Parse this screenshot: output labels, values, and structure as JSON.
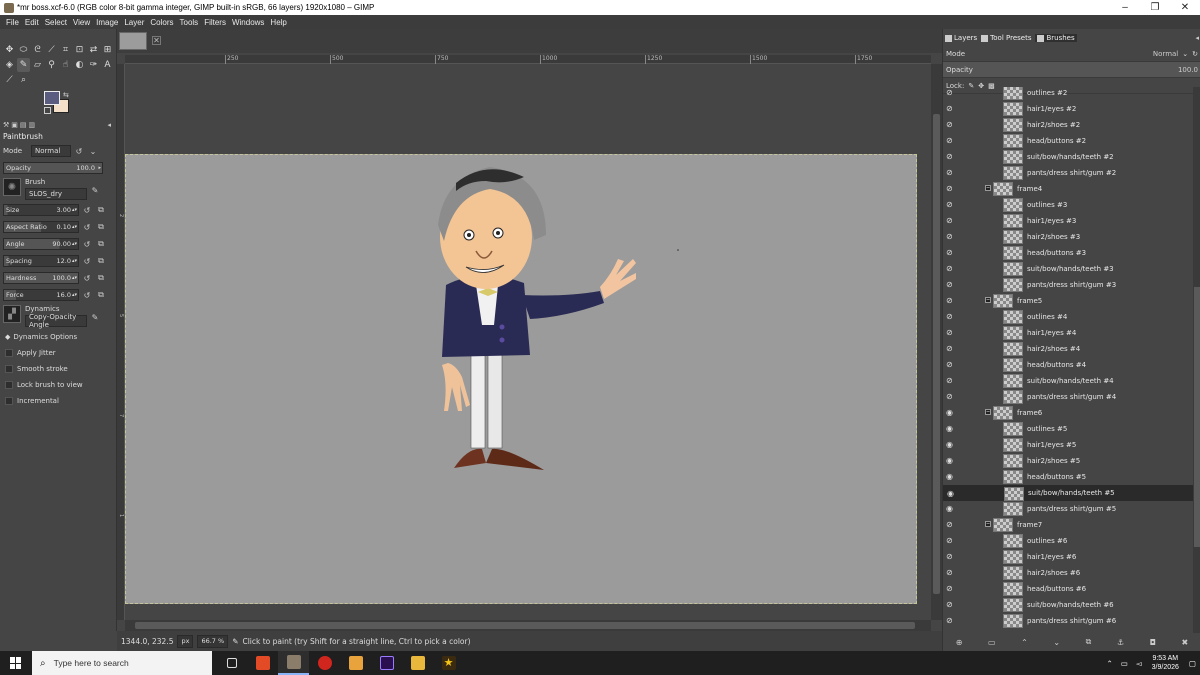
{
  "window": {
    "title": "*mr boss.xcf-6.0 (RGB color 8-bit gamma integer, GIMP built-in sRGB, 66 layers) 1920x1080 – GIMP"
  },
  "menu": [
    "File",
    "Edit",
    "Select",
    "View",
    "Image",
    "Layer",
    "Colors",
    "Tools",
    "Filters",
    "Windows",
    "Help"
  ],
  "tool_options": {
    "title": "Paintbrush",
    "mode_label": "Mode",
    "mode_value": "Normal",
    "opacity_label": "Opacity",
    "opacity_value": "100.0",
    "brush_label": "Brush",
    "brush_value": "SLOS_dry",
    "sliders": [
      {
        "label": "Size",
        "value": "3.00",
        "fill": 0.05
      },
      {
        "label": "Aspect Ratio",
        "value": "0.10",
        "fill": 0.5
      },
      {
        "label": "Angle",
        "value": "90.00",
        "fill": 0.75
      },
      {
        "label": "Spacing",
        "value": "12.0",
        "fill": 0.06
      },
      {
        "label": "Hardness",
        "value": "100.0",
        "fill": 1.0
      },
      {
        "label": "Force",
        "value": "16.0",
        "fill": 0.16
      }
    ],
    "dynamics_label": "Dynamics",
    "dynamics_value": "Copy-Opacity Angle",
    "dynamics_options": "Dynamics Options",
    "checks": [
      "Apply Jitter",
      "Smooth stroke",
      "Lock brush to view",
      "Incremental"
    ]
  },
  "ruler": {
    "ticks": [
      "250",
      "500",
      "750",
      "1000",
      "1250",
      "1500",
      "1750"
    ]
  },
  "status": {
    "coords": "1344.0, 232.5",
    "unit": "px",
    "zoom": "66.7 %",
    "message": "Click to paint (try Shift for a straight line, Ctrl to pick a color)"
  },
  "dock": {
    "tabs": [
      "Layers",
      "Tool Presets",
      "Brushes"
    ],
    "mode_label": "Mode",
    "mode_value": "Normal",
    "opacity_label": "Opacity",
    "opacity_value": "100.0",
    "lock_label": "Lock:",
    "layers": [
      {
        "name": "outlines #2",
        "type": "layer",
        "visible": false
      },
      {
        "name": "hair1/eyes #2",
        "type": "layer",
        "visible": false
      },
      {
        "name": "hair2/shoes #2",
        "type": "layer",
        "visible": false
      },
      {
        "name": "head/buttons #2",
        "type": "layer",
        "visible": false
      },
      {
        "name": "suit/bow/hands/teeth #2",
        "type": "layer",
        "visible": false
      },
      {
        "name": "pants/dress shirt/gum #2",
        "type": "layer",
        "visible": false
      },
      {
        "name": "frame4",
        "type": "group",
        "visible": false
      },
      {
        "name": "outlines #3",
        "type": "layer",
        "visible": false
      },
      {
        "name": "hair1/eyes #3",
        "type": "layer",
        "visible": false
      },
      {
        "name": "hair2/shoes #3",
        "type": "layer",
        "visible": false
      },
      {
        "name": "head/buttons #3",
        "type": "layer",
        "visible": false
      },
      {
        "name": "suit/bow/hands/teeth #3",
        "type": "layer",
        "visible": false
      },
      {
        "name": "pants/dress shirt/gum #3",
        "type": "layer",
        "visible": false
      },
      {
        "name": "frame5",
        "type": "group",
        "visible": false
      },
      {
        "name": "outlines #4",
        "type": "layer",
        "visible": false
      },
      {
        "name": "hair1/eyes #4",
        "type": "layer",
        "visible": false
      },
      {
        "name": "hair2/shoes #4",
        "type": "layer",
        "visible": false
      },
      {
        "name": "head/buttons #4",
        "type": "layer",
        "visible": false
      },
      {
        "name": "suit/bow/hands/teeth #4",
        "type": "layer",
        "visible": false
      },
      {
        "name": "pants/dress shirt/gum #4",
        "type": "layer",
        "visible": false
      },
      {
        "name": "frame6",
        "type": "group",
        "visible": true
      },
      {
        "name": "outlines #5",
        "type": "layer",
        "visible": true
      },
      {
        "name": "hair1/eyes #5",
        "type": "layer",
        "visible": true
      },
      {
        "name": "hair2/shoes #5",
        "type": "layer",
        "visible": true
      },
      {
        "name": "head/buttons #5",
        "type": "layer",
        "visible": true
      },
      {
        "name": "suit/bow/hands/teeth #5",
        "type": "layer",
        "visible": true,
        "selected": true
      },
      {
        "name": "pants/dress shirt/gum #5",
        "type": "layer",
        "visible": true
      },
      {
        "name": "frame7",
        "type": "group",
        "visible": false
      },
      {
        "name": "outlines #6",
        "type": "layer",
        "visible": false
      },
      {
        "name": "hair1/eyes #6",
        "type": "layer",
        "visible": false
      },
      {
        "name": "hair2/shoes #6",
        "type": "layer",
        "visible": false
      },
      {
        "name": "head/buttons #6",
        "type": "layer",
        "visible": false
      },
      {
        "name": "suit/bow/hands/teeth #6",
        "type": "layer",
        "visible": false
      },
      {
        "name": "pants/dress shirt/gum #6",
        "type": "layer",
        "visible": false
      }
    ]
  },
  "taskbar": {
    "search_placeholder": "Type here to search",
    "time": "9:53 AM",
    "date": "3/9/2026"
  }
}
